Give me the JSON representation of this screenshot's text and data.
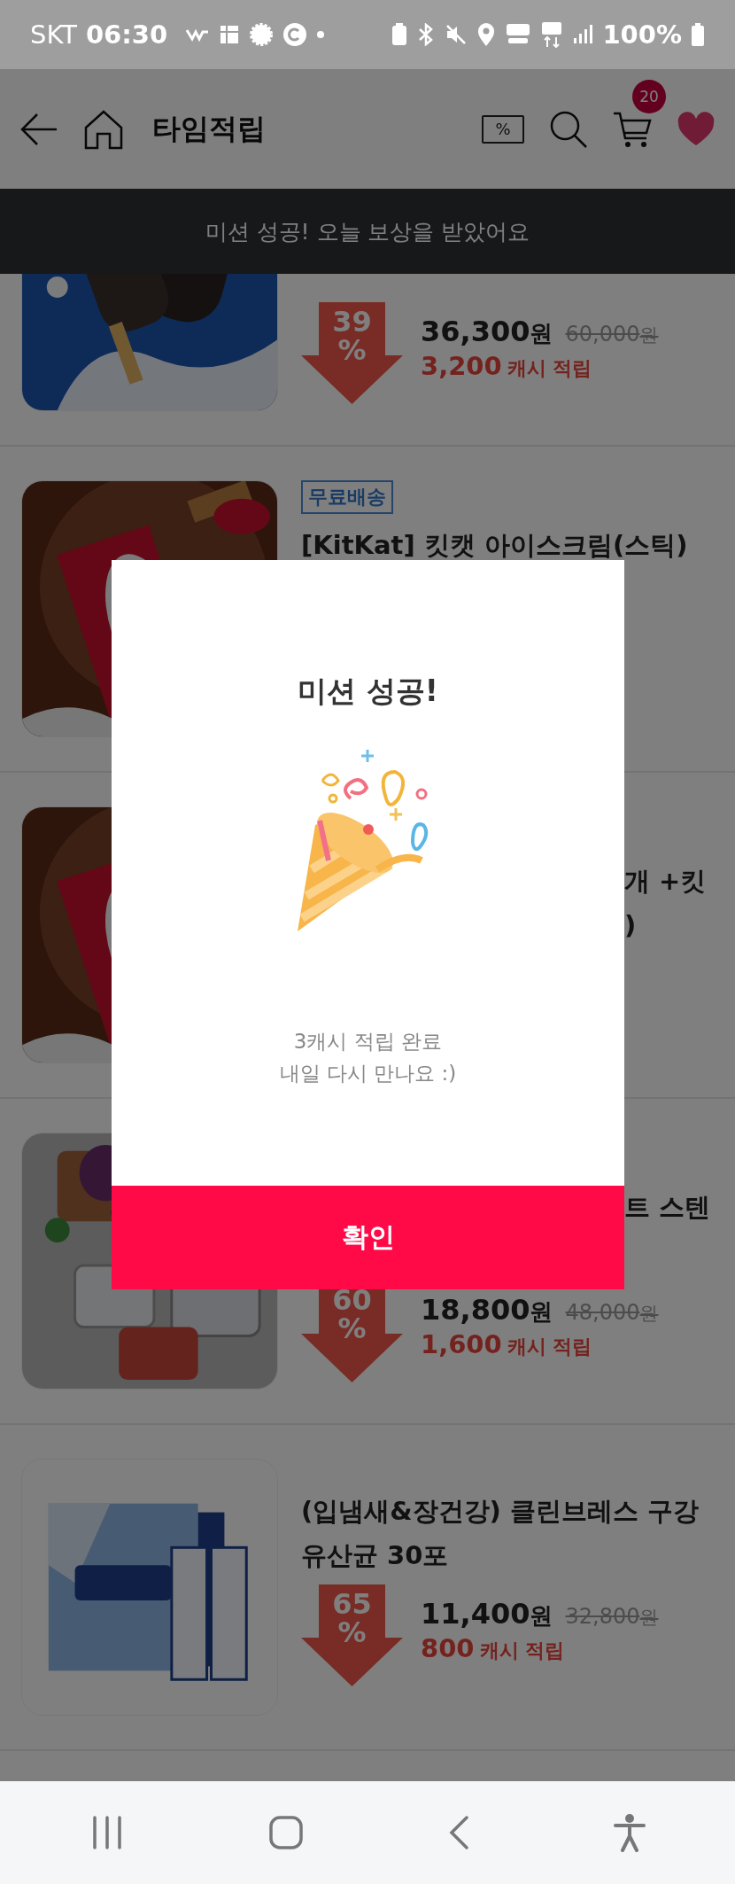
{
  "status_bar": {
    "carrier": "SKT",
    "time": "06:30",
    "battery": "100%"
  },
  "header": {
    "title": "타임적립",
    "coupon_label": "%",
    "cart_count": "20"
  },
  "toast": {
    "message": "미션 성공! 오늘 보상을 받았어요"
  },
  "products": [
    {
      "title_lines": [
        {
          "kind": "hidden"
        },
        {
          "kind": "hidden"
        },
        {
          "kind": "hidden"
        }
      ],
      "discount": "39",
      "discount_unit": "%",
      "price": "36,300",
      "price_unit": "원",
      "original_price": "60,000",
      "original_unit": "원",
      "cash": "3,200",
      "cash_label": "캐시 적립"
    },
    {
      "badge": "무료배송",
      "title_lines": [
        {
          "kind": "full",
          "text": "[KitKat] 킷캣 아이스크림(스틱)"
        },
        {
          "kind": "hidden"
        },
        {
          "kind": "hidden"
        }
      ]
    },
    {
      "title_lines": [
        {
          "kind": "hidden"
        },
        {
          "kind": "tail",
          "text": "개 +킷"
        },
        {
          "kind": "tail",
          "text": ")"
        }
      ]
    },
    {
      "title_lines": [
        {
          "kind": "hidden"
        },
        {
          "kind": "tail",
          "text": "트 스텐"
        },
        {
          "kind": "hidden"
        }
      ],
      "discount": "60",
      "discount_unit": "%",
      "price": "18,800",
      "price_unit": "원",
      "original_price": "48,000",
      "original_unit": "원",
      "cash": "1,600",
      "cash_label": "캐시 적립"
    },
    {
      "title_lines": [
        {
          "kind": "full",
          "text": "(입냄새&장건강) 클린브레스 구강"
        },
        {
          "kind": "full",
          "text": "유산균 30포"
        }
      ],
      "discount": "65",
      "discount_unit": "%",
      "price": "11,400",
      "price_unit": "원",
      "original_price": "32,800",
      "original_unit": "원",
      "cash": "800",
      "cash_label": "캐시 적립"
    }
  ],
  "modal": {
    "title": "미션 성공!",
    "message_lines": [
      "3캐시 적립 완료",
      "내일 다시 만나요 :)"
    ],
    "confirm": "확인"
  }
}
